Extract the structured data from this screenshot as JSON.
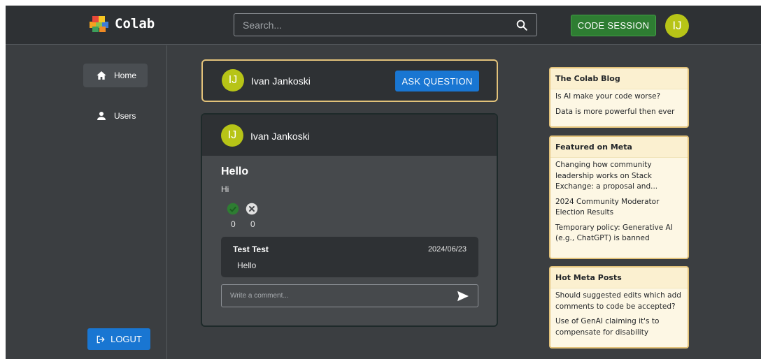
{
  "app": {
    "name": "Colab"
  },
  "header": {
    "search_placeholder": "Search...",
    "code_session_label": "CODE SESSION",
    "user_initials": "IJ"
  },
  "sidebar": {
    "items": [
      {
        "label": "Home",
        "icon": "home-icon",
        "active": true
      },
      {
        "label": "Users",
        "icon": "user-icon",
        "active": false
      }
    ],
    "logout_label": "LOGUT"
  },
  "ask": {
    "initials": "IJ",
    "name": "Ivan Jankoski",
    "button_label": "ASK QUESTION"
  },
  "post": {
    "initials": "IJ",
    "author": "Ivan Jankoski",
    "title": "Hello",
    "body": "Hi",
    "upvotes": "0",
    "downvotes": "0",
    "comments": [
      {
        "author": "Test Test",
        "date": "2024/06/23",
        "text": "Hello"
      }
    ],
    "comment_placeholder": "Write a comment..."
  },
  "widgets": [
    {
      "title": "The Colab Blog",
      "items": [
        "Is AI make your code worse?",
        "Data is more powerful then ever"
      ]
    },
    {
      "title": "Featured on Meta",
      "items": [
        "Changing how community leadership works on Stack Exchange: a proposal and...",
        "2024 Community Moderator Election Results",
        "Temporary policy: Generative AI (e.g., ChatGPT) is banned"
      ]
    },
    {
      "title": "Hot Meta Posts",
      "items": [
        "Should suggested edits which add comments to code be accepted?",
        "Use of GenAI claiming it's to compensate for disability"
      ]
    }
  ],
  "colors": {
    "background": "#3b3e41",
    "topbar": "#2e3134",
    "primary": "#1976d2",
    "success": "#2e7d32",
    "avatar": "#b7c417",
    "widget_border": "#e2c27a",
    "widget_bg": "#fdf7e4"
  }
}
